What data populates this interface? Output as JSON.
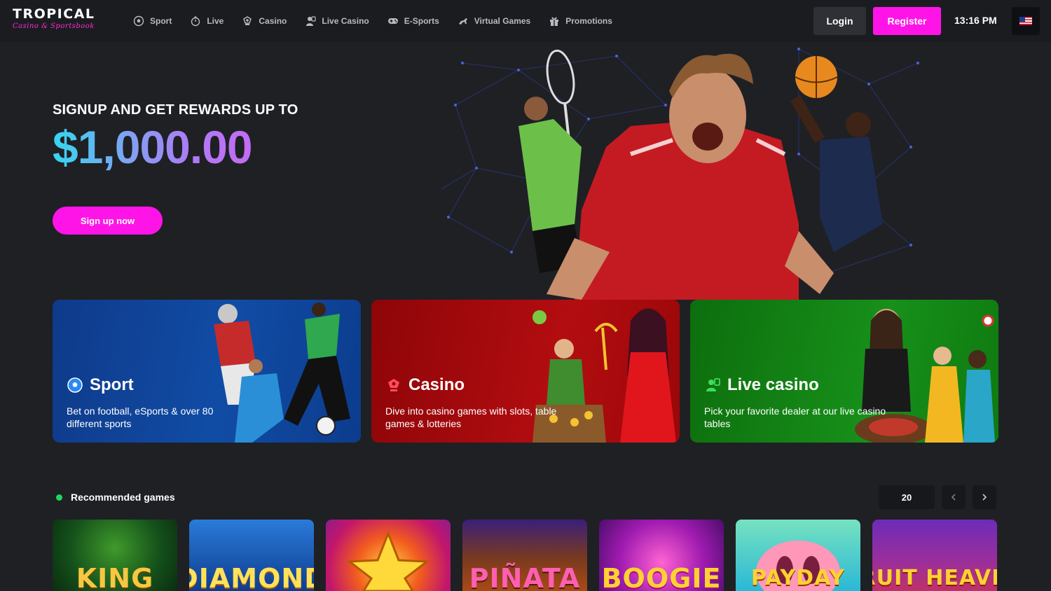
{
  "brand": {
    "name": "TROPICAL",
    "tagline": "Casino & Sportsbook"
  },
  "nav": [
    {
      "label": "Sport",
      "icon": "soccer-ball-icon"
    },
    {
      "label": "Live",
      "icon": "stopwatch-icon"
    },
    {
      "label": "Casino",
      "icon": "poker-chip-icon"
    },
    {
      "label": "Live Casino",
      "icon": "dealer-icon"
    },
    {
      "label": "E-Sports",
      "icon": "gamepad-icon"
    },
    {
      "label": "Virtual Games",
      "icon": "horse-racing-icon"
    },
    {
      "label": "Promotions",
      "icon": "gift-icon"
    }
  ],
  "header": {
    "login_label": "Login",
    "register_label": "Register",
    "time": "13:16 PM",
    "language_flag": "us-flag-icon"
  },
  "hero": {
    "kicker": "SIGNUP AND GET REWARDS UP TO",
    "amount": "$1,000.00",
    "cta_label": "Sign up now"
  },
  "categories": [
    {
      "title": "Sport",
      "description": "Bet on football, eSports & over 80 different sports",
      "icon": "soccer-ball-icon",
      "color": "#104ca5"
    },
    {
      "title": "Casino",
      "description": "Dive into casino games with slots, table games & lotteries",
      "icon": "poker-chip-icon",
      "color": "#b30d10"
    },
    {
      "title": "Live casino",
      "description": "Pick your favorite dealer at our live casino tables",
      "icon": "dealer-icon",
      "color": "#17901a"
    }
  ],
  "recommended": {
    "title": "Recommended games",
    "count": "20",
    "games": [
      {
        "label": "KING"
      },
      {
        "label": "DIAMOND"
      },
      {
        "label": ""
      },
      {
        "label": "PIÑATA"
      },
      {
        "label": "BOOGIE"
      },
      {
        "label": "PAYDAY"
      },
      {
        "label": "FRUIT HEAVEN"
      }
    ]
  },
  "colors": {
    "accent": "#ff14e8",
    "background": "#1f2024",
    "header": "#1b1c20",
    "status_dot": "#1ed760"
  }
}
